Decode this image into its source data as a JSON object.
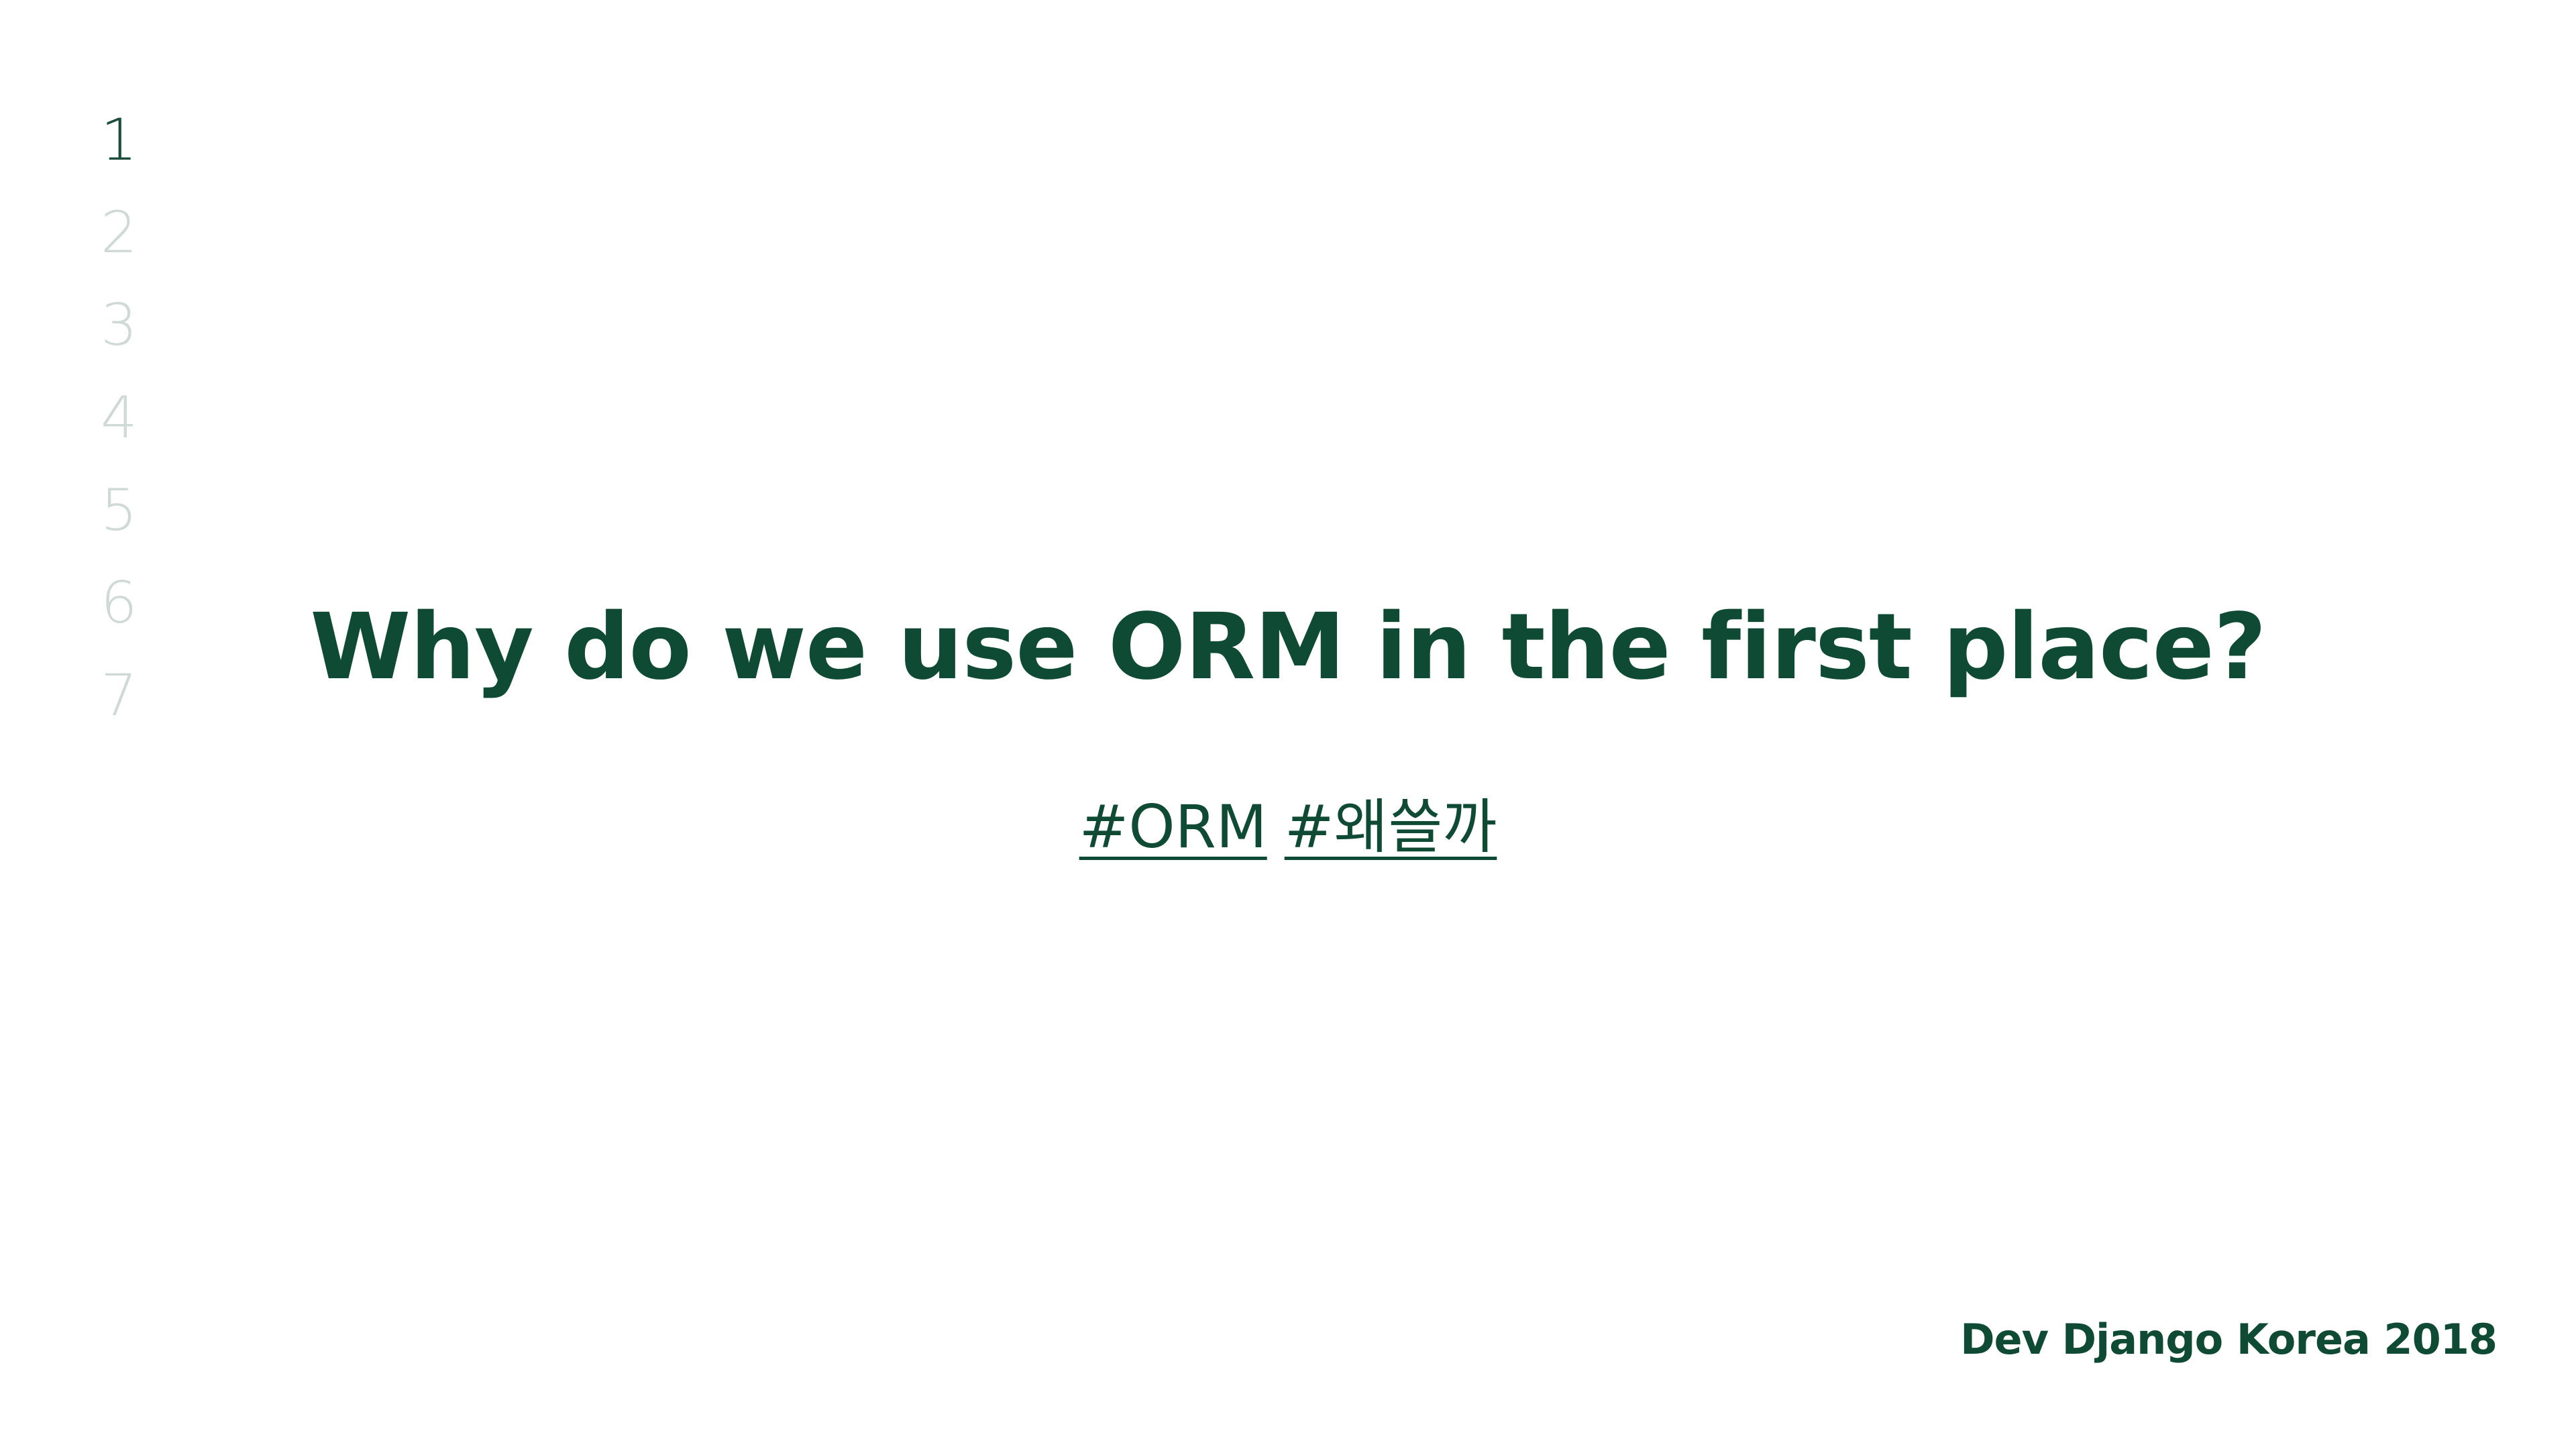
{
  "nav": {
    "pages": [
      "1",
      "2",
      "3",
      "4",
      "5",
      "6",
      "7"
    ],
    "active_index": 0
  },
  "slide": {
    "title": "Why do we use ORM in the first place?",
    "tags": [
      "#ORM",
      "#왜쓸까"
    ]
  },
  "footer": {
    "text": "Dev Django Korea 2018"
  },
  "colors": {
    "primary": "#0f4a34",
    "inactive_page": "#cfd9d5",
    "background": "#ffffff"
  }
}
